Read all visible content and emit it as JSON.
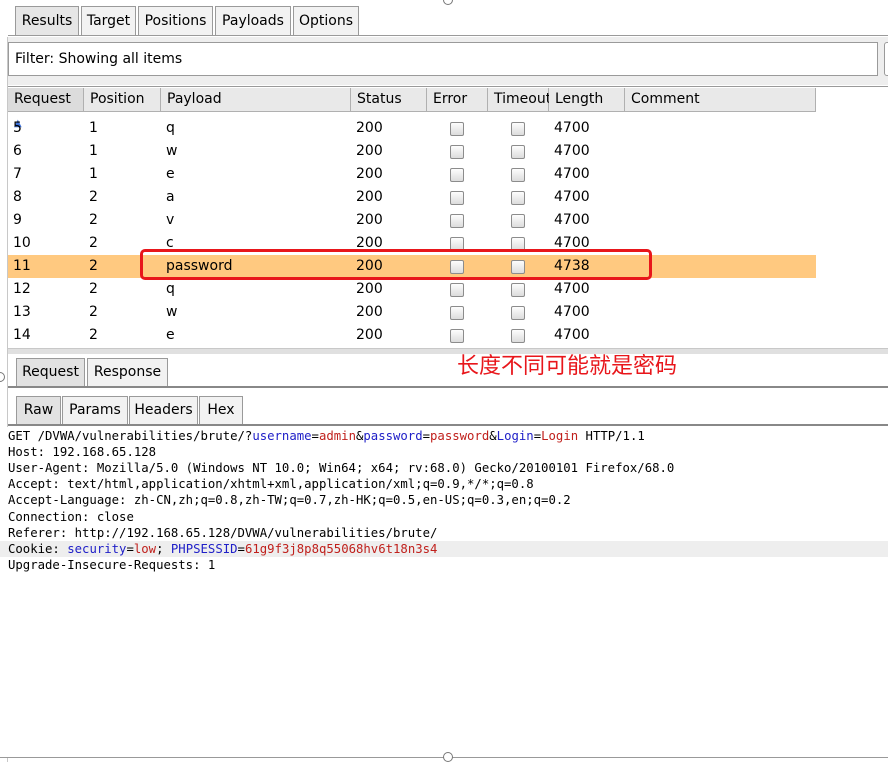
{
  "top_tabs": [
    {
      "label": "Results",
      "active": true
    },
    {
      "label": "Target",
      "active": false
    },
    {
      "label": "Positions",
      "active": false
    },
    {
      "label": "Payloads",
      "active": false
    },
    {
      "label": "Options",
      "active": false
    }
  ],
  "filter": {
    "text": "Filter: Showing all items"
  },
  "table": {
    "columns": [
      "Request",
      "Position",
      "Payload",
      "Status",
      "Error",
      "Timeout",
      "Length",
      "Comment"
    ],
    "sort_indicator": "▲",
    "rows": [
      {
        "request": "5",
        "position": "1",
        "payload": "q",
        "status": "200",
        "error": false,
        "timeout": false,
        "length": "4700",
        "comment": ""
      },
      {
        "request": "6",
        "position": "1",
        "payload": "w",
        "status": "200",
        "error": false,
        "timeout": false,
        "length": "4700",
        "comment": ""
      },
      {
        "request": "7",
        "position": "1",
        "payload": "e",
        "status": "200",
        "error": false,
        "timeout": false,
        "length": "4700",
        "comment": ""
      },
      {
        "request": "8",
        "position": "2",
        "payload": "a",
        "status": "200",
        "error": false,
        "timeout": false,
        "length": "4700",
        "comment": ""
      },
      {
        "request": "9",
        "position": "2",
        "payload": "v",
        "status": "200",
        "error": false,
        "timeout": false,
        "length": "4700",
        "comment": ""
      },
      {
        "request": "10",
        "position": "2",
        "payload": "c",
        "status": "200",
        "error": false,
        "timeout": false,
        "length": "4700",
        "comment": ""
      },
      {
        "request": "11",
        "position": "2",
        "payload": "password",
        "status": "200",
        "error": false,
        "timeout": false,
        "length": "4738",
        "comment": "",
        "selected": true
      },
      {
        "request": "12",
        "position": "2",
        "payload": "q",
        "status": "200",
        "error": false,
        "timeout": false,
        "length": "4700",
        "comment": ""
      },
      {
        "request": "13",
        "position": "2",
        "payload": "w",
        "status": "200",
        "error": false,
        "timeout": false,
        "length": "4700",
        "comment": ""
      },
      {
        "request": "14",
        "position": "2",
        "payload": "e",
        "status": "200",
        "error": false,
        "timeout": false,
        "length": "4700",
        "comment": ""
      }
    ]
  },
  "annotation": {
    "text": "长度不同可能就是密码"
  },
  "reqresp_tabs": [
    {
      "label": "Request",
      "active": true
    },
    {
      "label": "Response",
      "active": false
    }
  ],
  "view_tabs": [
    {
      "label": "Raw",
      "active": true
    },
    {
      "label": "Params",
      "active": false
    },
    {
      "label": "Headers",
      "active": false
    },
    {
      "label": "Hex",
      "active": false
    }
  ],
  "request": {
    "line1": {
      "prefix": "GET /DVWA/vulnerabilities/brute/?",
      "k1": "username",
      "eq1": "=",
      "v1": "admin",
      "amp1": "&",
      "k2": "password",
      "eq2": "=",
      "v2": "password",
      "amp2": "&",
      "k3": "Login",
      "eq3": "=",
      "v3": "Login",
      "suffix": " HTTP/1.1"
    },
    "host": "Host: 192.168.65.128",
    "user_agent": "User-Agent: Mozilla/5.0 (Windows NT 10.0; Win64; x64; rv:68.0) Gecko/20100101 Firefox/68.0",
    "accept": "Accept: text/html,application/xhtml+xml,application/xml;q=0.9,*/*;q=0.8",
    "accept_language": "Accept-Language: zh-CN,zh;q=0.8,zh-TW;q=0.7,zh-HK;q=0.5,en-US;q=0.3,en;q=0.2",
    "connection": "Connection: close",
    "referer": "Referer: http://192.168.65.128/DVWA/vulnerabilities/brute/",
    "cookie": {
      "prefix": "Cookie: ",
      "k1": "security",
      "eq1": "=",
      "v1": "low",
      "sep": "; ",
      "k2": "PHPSESSID",
      "eq2": "=",
      "v2": "61g9f3j8p8q55068hv6t18n3s4"
    },
    "upgrade": "Upgrade-Insecure-Requests: 1"
  },
  "colors": {
    "highlight_row": "#ffc980",
    "annotation": "#e8161b",
    "param_key": "#2020c8",
    "param_value": "#c0201c"
  }
}
